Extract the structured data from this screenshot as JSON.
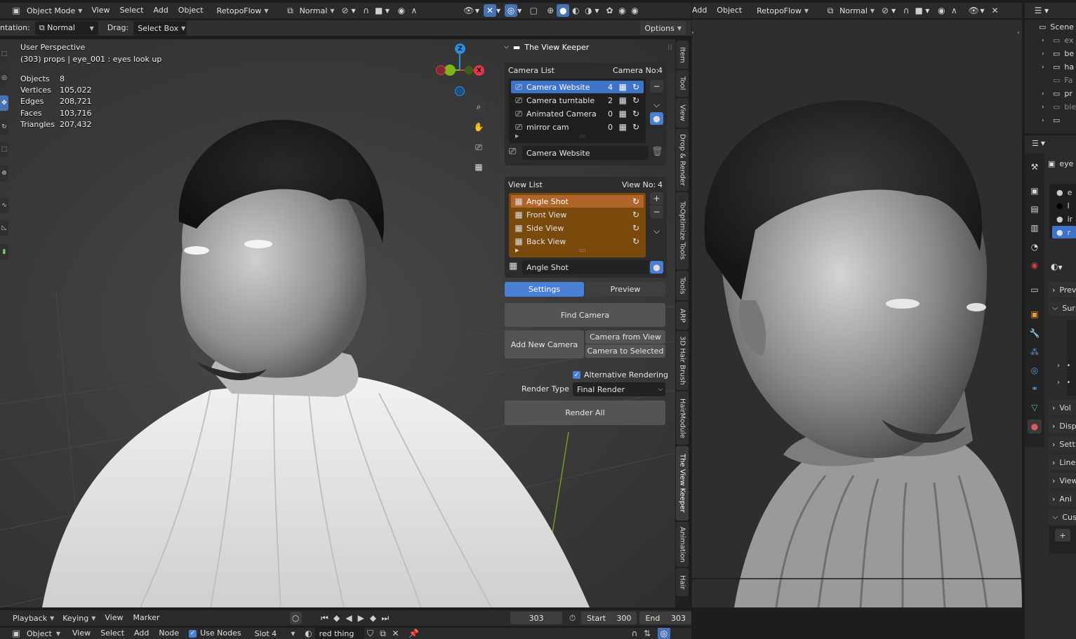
{
  "top_header_left": {
    "mode": "Object Mode",
    "menus": [
      "View",
      "Select",
      "Add",
      "Object"
    ],
    "addon_menu": "RetopoFlow",
    "orientation": "Normal"
  },
  "top_header_right": {
    "menus": [
      "Add",
      "Object"
    ],
    "addon_menu": "RetopoFlow",
    "orientation": "Normal"
  },
  "tool_settings": {
    "orientation_label": "ntation:",
    "orientation_value": "Normal",
    "drag_label": "Drag:",
    "drag_value": "Select Box",
    "options_label": "Options"
  },
  "viewport_info": {
    "perspective": "User Perspective",
    "object_line": "(303) props | eye_001 : eyes look up",
    "stats": [
      {
        "label": "Objects",
        "value": "8"
      },
      {
        "label": "Vertices",
        "value": "105,022"
      },
      {
        "label": "Edges",
        "value": "208,721"
      },
      {
        "label": "Faces",
        "value": "103,716"
      },
      {
        "label": "Triangles",
        "value": "207,432"
      }
    ]
  },
  "gizmo": {
    "z": "Z",
    "y": "",
    "x": "X"
  },
  "view_keeper": {
    "title": "The View Keeper",
    "camera_list_label": "Camera List",
    "camera_no_label": "Camera No:",
    "camera_no": "4",
    "cameras": [
      {
        "name": "Camera Website",
        "count": "4"
      },
      {
        "name": "Camera turntable",
        "count": "2"
      },
      {
        "name": "Animated Camera",
        "count": "0"
      },
      {
        "name": "mirror cam",
        "count": "0"
      }
    ],
    "camera_selected": "Camera Website",
    "view_list_label": "View List",
    "view_no_label": "View No:",
    "view_no": "4",
    "views": [
      "Angle Shot",
      "Front View",
      "Side View",
      "Back View"
    ],
    "view_selected": "Angle Shot",
    "tabs": {
      "settings": "Settings",
      "preview": "Preview"
    },
    "find_camera": "Find Camera",
    "add_new_camera": "Add New Camera",
    "camera_from_view": "Camera from View",
    "camera_to_selected": "Camera to Selected",
    "alt_rendering": "Alternative Rendering",
    "render_type_label": "Render Type",
    "render_type_value": "Final Render",
    "render_all": "Render All"
  },
  "sidebar_tabs": [
    "Item",
    "Tool",
    "View",
    "Drop & Render",
    "ToOptimize Tools",
    "Tools",
    "ARP",
    "3D Hair Brush",
    "HairModule",
    "The View Keeper",
    "Animation",
    "Hair"
  ],
  "outliner": {
    "scene": "Scene",
    "items": [
      "ex",
      "be",
      "ha",
      "Fa",
      "pr",
      "ble",
      ""
    ]
  },
  "properties": {
    "object_name": "eye",
    "slots": [
      "e",
      "l",
      "ir",
      "r"
    ],
    "sections": [
      "Prev",
      "Sur",
      "Vol",
      "Disp",
      "Sett",
      "Line",
      "View",
      "Ani",
      "Cus"
    ],
    "sub_items": [
      "•",
      "•"
    ],
    "add": "+"
  },
  "timeline": {
    "menus": [
      "Playback",
      "Keying",
      "View",
      "Marker"
    ],
    "current_frame": "303",
    "start_label": "Start",
    "start": "300",
    "end_label": "End",
    "end": "303"
  },
  "node_header": {
    "mode": "Object",
    "menus": [
      "View",
      "Select",
      "Add",
      "Node"
    ],
    "use_nodes": "Use Nodes",
    "slot": "Slot 4",
    "material": "red thing"
  },
  "colors": {
    "accent_blue": "#4a7fd6",
    "view_list_bg": "#7a4a0c",
    "view_list_sel": "#b0662a",
    "axis_x": "#e8344a",
    "axis_y": "#7ab61c",
    "axis_z": "#2a8fe0"
  }
}
